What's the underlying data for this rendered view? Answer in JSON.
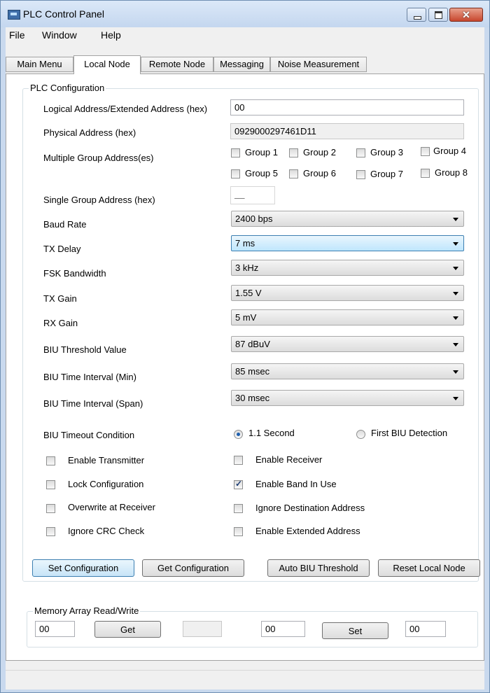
{
  "window": {
    "title": "PLC Control Panel",
    "minimize": "",
    "maximize": "",
    "close": "✕"
  },
  "menu": [
    "File",
    "Window",
    "Help"
  ],
  "tabs": [
    "Main Menu",
    "Local Node",
    "Remote Node",
    "Messaging",
    "Noise Measurement"
  ],
  "config": {
    "group_title": "PLC Configuration",
    "logical_address_label": "Logical Address/Extended Address (hex)",
    "logical_address_value": "00",
    "physical_address_label": "Physical Address (hex)",
    "physical_address_value": "0929000297461D11",
    "multiple_group_label": "Multiple Group Address(es)",
    "groups": [
      "Group 1",
      "Group 2",
      "Group 3",
      "Group 4",
      "Group 5",
      "Group 6",
      "Group 7",
      "Group 8"
    ],
    "single_group_label": "Single Group Address (hex)",
    "single_group_value": "__",
    "baud_rate_label": "Baud Rate",
    "baud_rate_value": "2400 bps",
    "tx_delay_label": "TX Delay",
    "tx_delay_value": "7 ms",
    "fsk_bandwidth_label": "FSK Bandwidth",
    "fsk_bandwidth_value": "3 kHz",
    "tx_gain_label": "TX Gain",
    "tx_gain_value": "1.55 V",
    "rx_gain_label": "RX Gain",
    "rx_gain_value": "5 mV",
    "biu_threshold_label": "BIU Threshold Value",
    "biu_threshold_value": "87 dBuV",
    "biu_interval_min_label": "BIU Time Interval (Min)",
    "biu_interval_min_value": "85 msec",
    "biu_interval_span_label": "BIU Time Interval (Span)",
    "biu_interval_span_value": "30 msec",
    "biu_timeout_label": "BIU Timeout Condition",
    "timeout_option_1": "1.1 Second",
    "timeout_option_2": "First BIU Detection",
    "enable_transmitter": "Enable Transmitter",
    "enable_receiver": "Enable Receiver",
    "lock_configuration": "Lock Configuration",
    "enable_band_in_use": "Enable Band In Use",
    "overwrite_at_receiver": "Overwrite at Receiver",
    "ignore_destination": "Ignore Destination Address",
    "ignore_crc": "Ignore CRC Check",
    "enable_extended": "Enable Extended Address"
  },
  "buttons": {
    "set_configuration": "Set Configuration",
    "get_configuration": "Get Configuration",
    "auto_biu": "Auto BIU Threshold",
    "reset_local": "Reset Local Node"
  },
  "memory": {
    "group_title": "Memory Array Read/Write",
    "read_address": "00",
    "get_label": "Get",
    "read_result": "",
    "write_address": "00",
    "set_label": "Set",
    "write_value": "00"
  },
  "status_text": ""
}
